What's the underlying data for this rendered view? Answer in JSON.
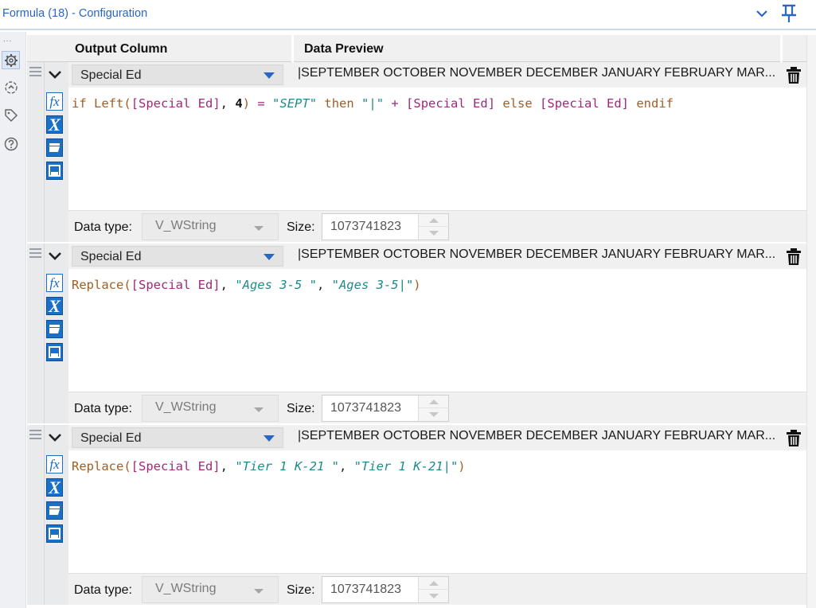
{
  "window": {
    "title": "Formula (18) - Configuration"
  },
  "grid": {
    "col_output": "Output Column",
    "col_preview": "Data Preview"
  },
  "formulas": [
    {
      "column": "Special Ed",
      "preview": "|SEPTEMBER OCTOBER NOVEMBER DECEMBER JANUARY FEBRUARY MAR...",
      "expr": {
        "t0": "if",
        "t1": "Left(",
        "t2": "[Special Ed]",
        "t3": ", ",
        "t4": "4",
        "t5": ") ",
        "t6": "=",
        "t7": " ",
        "t8": "\"SEPT\"",
        "t9": " then ",
        "t10": "\"|\"",
        "t11": " + ",
        "t12": "[Special Ed]",
        "t13": " else ",
        "t14": "[Special Ed]",
        "t15": " endif"
      },
      "data_type_label": "Data type:",
      "data_type": "V_WString",
      "size_label": "Size:",
      "size": "1073741823"
    },
    {
      "column": "Special Ed",
      "preview": "|SEPTEMBER OCTOBER NOVEMBER DECEMBER JANUARY FEBRUARY MAR...",
      "expr": {
        "t0": "Replace(",
        "t1": "[Special Ed]",
        "t2": ", ",
        "t3": "\"Ages 3-5 \"",
        "t4": ", ",
        "t5": "\"Ages 3-5|\"",
        "t6": ")"
      },
      "data_type_label": "Data type:",
      "data_type": "V_WString",
      "size_label": "Size:",
      "size": "1073741823"
    },
    {
      "column": "Special Ed",
      "preview": "|SEPTEMBER OCTOBER NOVEMBER DECEMBER JANUARY FEBRUARY MAR...",
      "expr": {
        "t0": "Replace(",
        "t1": "[Special Ed]",
        "t2": ", ",
        "t3": "\"Tier 1 K-21 \"",
        "t4": ", ",
        "t5": "\"Tier 1 K-21|\"",
        "t6": ")"
      },
      "data_type_label": "Data type:",
      "data_type": "V_WString",
      "size_label": "Size:",
      "size": "1073741823"
    }
  ],
  "rail": {
    "dots": "..."
  },
  "icons": {
    "collapse": "chevron-down-icon",
    "pin": "pin-icon",
    "config": "gear-icon",
    "annotation": "arrow-circle-icon",
    "tag": "tag-icon",
    "help": "help-icon",
    "expand_row": "chevron-down-icon",
    "delete": "trash-icon",
    "fx": "fx-icon",
    "variable": "variable-x-icon",
    "open": "folder-open-icon",
    "save": "save-icon"
  },
  "colors": {
    "accent": "#2a66c5",
    "tool_blue": "#1a6fc7",
    "field": "#a0287a",
    "string": "#1e8a8a",
    "keyword": "#a15e24"
  }
}
